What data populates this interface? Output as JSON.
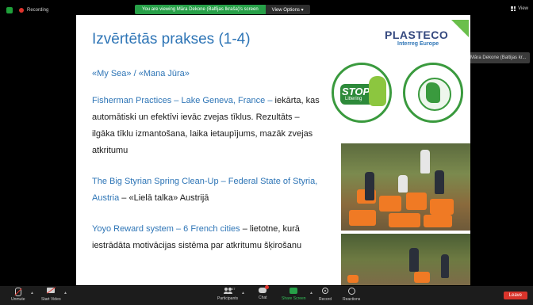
{
  "topbar": {
    "recording_label": "Recording",
    "viewing_text": "You are viewing Māra Dekone (Balfijas Ikraša)'s screen",
    "view_options_label": "View Options ▾",
    "view_label": "View",
    "talking_text": "Talking: Māra Dekone (Baltijas kr..."
  },
  "slide": {
    "title": "Izvērtētās prakses (1-4)",
    "subtitle": "«My Sea» / «Mana Jūra»",
    "p2_blue": "Fisherman Practices – Lake Geneva, France –",
    "p2_black": " iekārta, kas automātiski un efektīvi ievāc zvejas tīklus. Rezultāts – ilgāka tīklu izmantošana, laika ietaupījums, mazāk zvejas atkritumu",
    "p3_blue": "The Big Styrian Spring Clean-Up – Federal State of Styria, Austria",
    "p3_black": " – «Lielā talka» Austrijā",
    "p4_blue": "Yoyo Reward system – 6 French cities",
    "p4_black": " – lietotne, kurā iestrādāta motivācijas sistēma par atkritumu šķirošanu",
    "logo_main": "PLASTECO",
    "logo_sub": "Interreg Europe",
    "badge_stop_top": "STOP",
    "badge_stop_bottom": "Littering"
  },
  "toolbar": {
    "unmute": "Unmute",
    "start_video": "Start Video",
    "participants": "Participants",
    "participants_count": "47",
    "chat": "Chat",
    "share_screen": "Share Screen",
    "record": "Record",
    "reactions": "Reactions",
    "leave": "Leave"
  }
}
